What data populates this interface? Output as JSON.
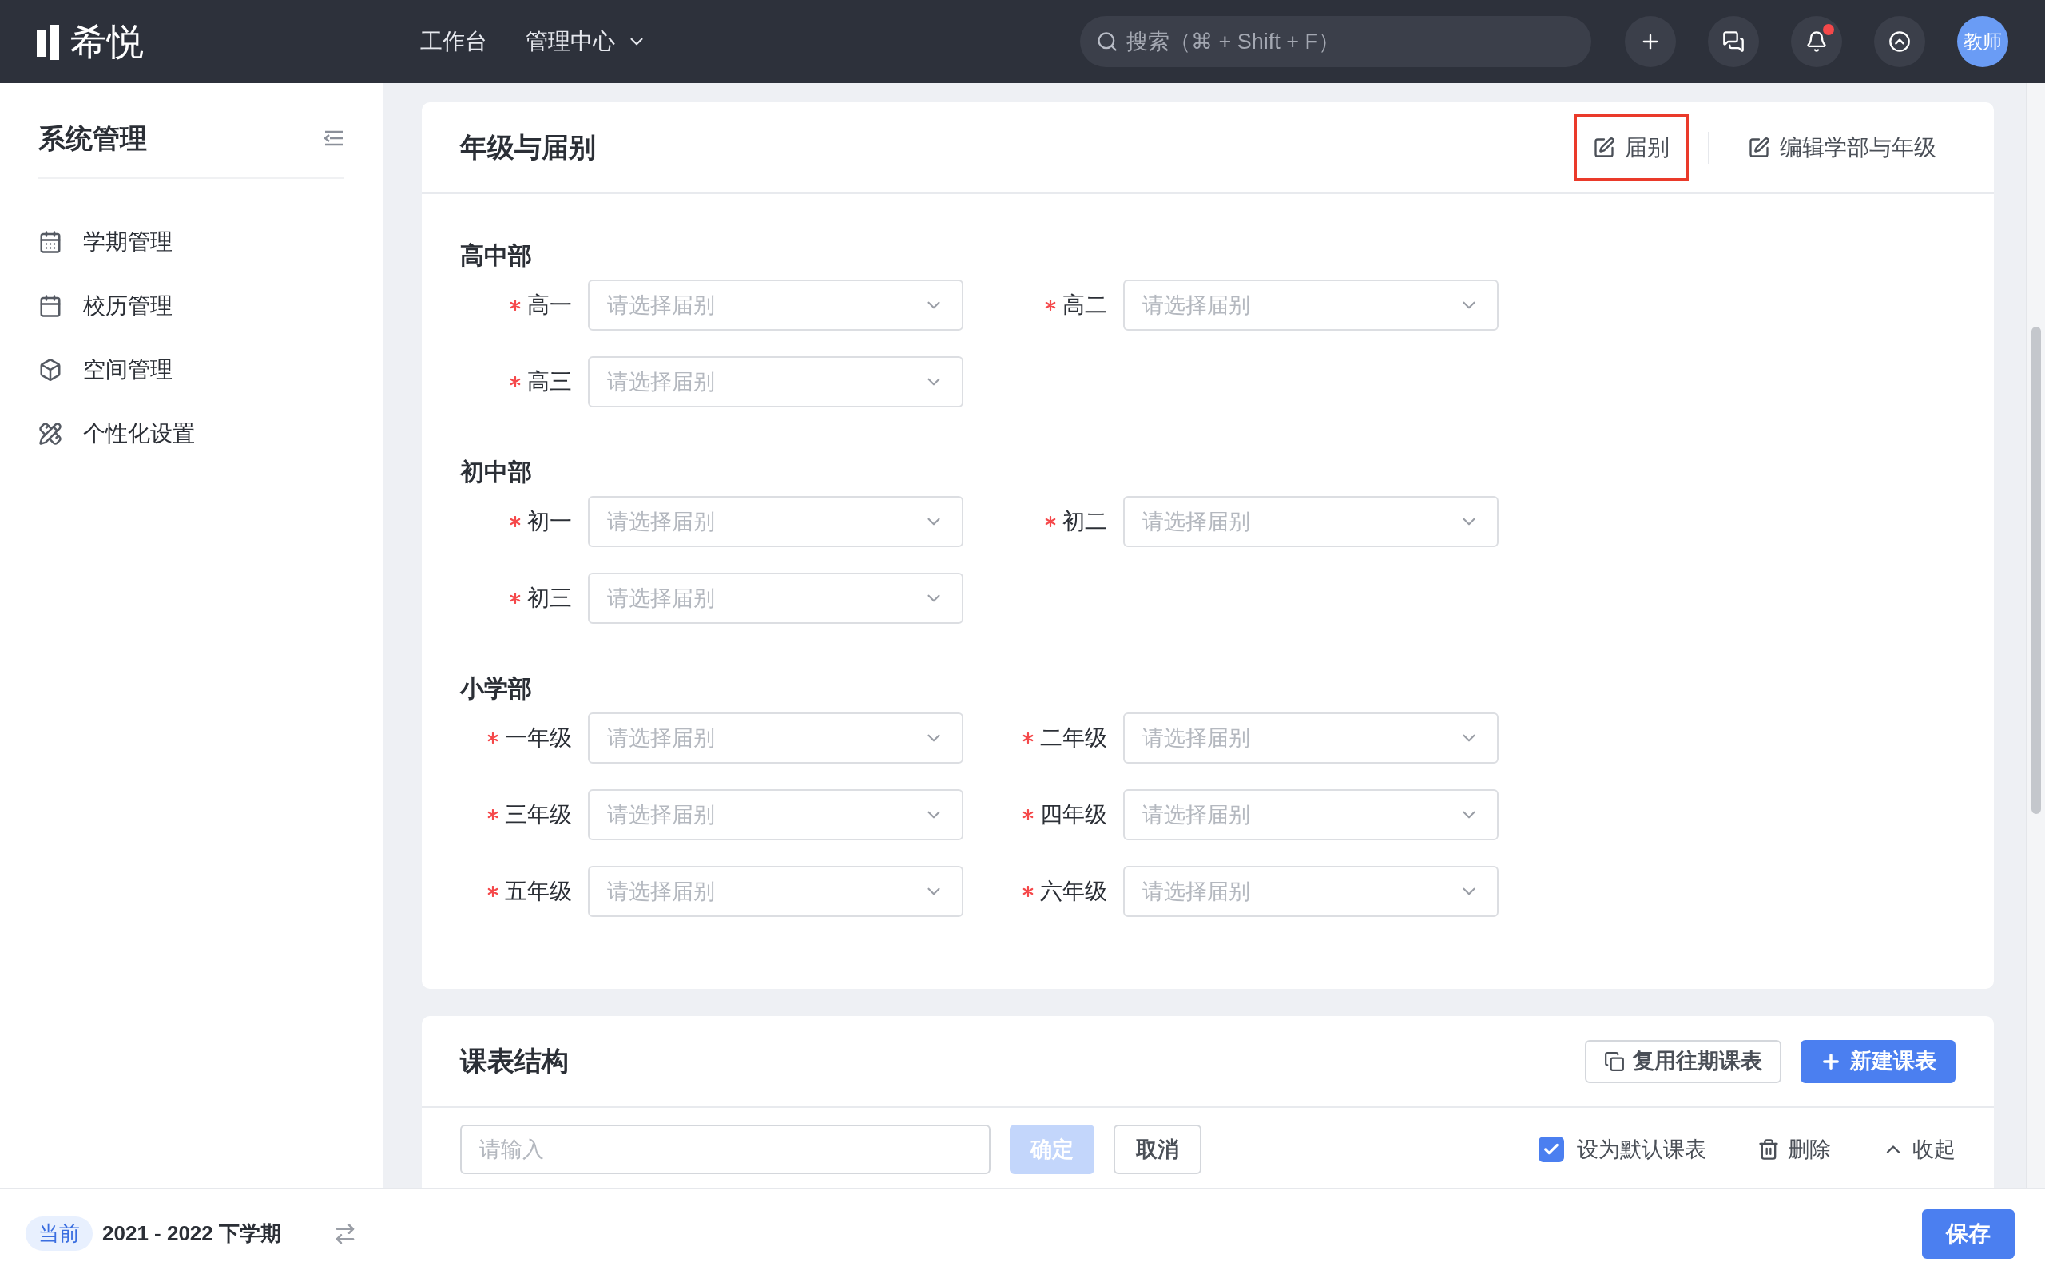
{
  "header": {
    "logo_text": "希悦",
    "nav": [
      {
        "label": "工作台",
        "dropdown": false
      },
      {
        "label": "管理中心",
        "dropdown": true
      }
    ],
    "search": {
      "placeholder": "搜索（⌘ + Shift + F）"
    },
    "notifications_unread": true,
    "avatar": "教师"
  },
  "sidebar": {
    "title": "系统管理",
    "items": [
      {
        "label": "学期管理"
      },
      {
        "label": "校历管理"
      },
      {
        "label": "空间管理"
      },
      {
        "label": "个性化设置"
      }
    ],
    "footer": {
      "badge": "当前",
      "term": "2021 - 2022 下学期"
    }
  },
  "grades_card": {
    "title": "年级与届别",
    "actions": [
      {
        "label": "届别",
        "highlighted": true
      },
      {
        "label": "编辑学部与年级",
        "highlighted": false
      }
    ],
    "sections": [
      {
        "title": "高中部",
        "fields": [
          {
            "label": "高一",
            "placeholder": "请选择届别",
            "required": true
          },
          {
            "label": "高二",
            "placeholder": "请选择届别",
            "required": true
          },
          {
            "label": "高三",
            "placeholder": "请选择届别",
            "required": true
          }
        ]
      },
      {
        "title": "初中部",
        "fields": [
          {
            "label": "初一",
            "placeholder": "请选择届别",
            "required": true
          },
          {
            "label": "初二",
            "placeholder": "请选择届别",
            "required": true
          },
          {
            "label": "初三",
            "placeholder": "请选择届别",
            "required": true
          }
        ]
      },
      {
        "title": "小学部",
        "fields": [
          {
            "label": "一年级",
            "placeholder": "请选择届别",
            "required": true
          },
          {
            "label": "二年级",
            "placeholder": "请选择届别",
            "required": true
          },
          {
            "label": "三年级",
            "placeholder": "请选择届别",
            "required": true
          },
          {
            "label": "四年级",
            "placeholder": "请选择届别",
            "required": true
          },
          {
            "label": "五年级",
            "placeholder": "请选择届别",
            "required": true
          },
          {
            "label": "六年级",
            "placeholder": "请选择届别",
            "required": true
          }
        ]
      }
    ]
  },
  "timetable_card": {
    "title": "课表结构",
    "buttons": [
      {
        "label": "复用往期课表",
        "kind": "outline"
      },
      {
        "label": "新建课表",
        "kind": "primary"
      }
    ],
    "name_input": {
      "placeholder": "请输入"
    },
    "confirm": {
      "label": "确定",
      "disabled": true
    },
    "cancel": {
      "label": "取消"
    },
    "default_checkbox": {
      "label": "设为默认课表",
      "checked": true
    },
    "delete": {
      "label": "删除"
    },
    "collapse": {
      "label": "收起"
    }
  },
  "footer": {
    "save": "保存"
  }
}
